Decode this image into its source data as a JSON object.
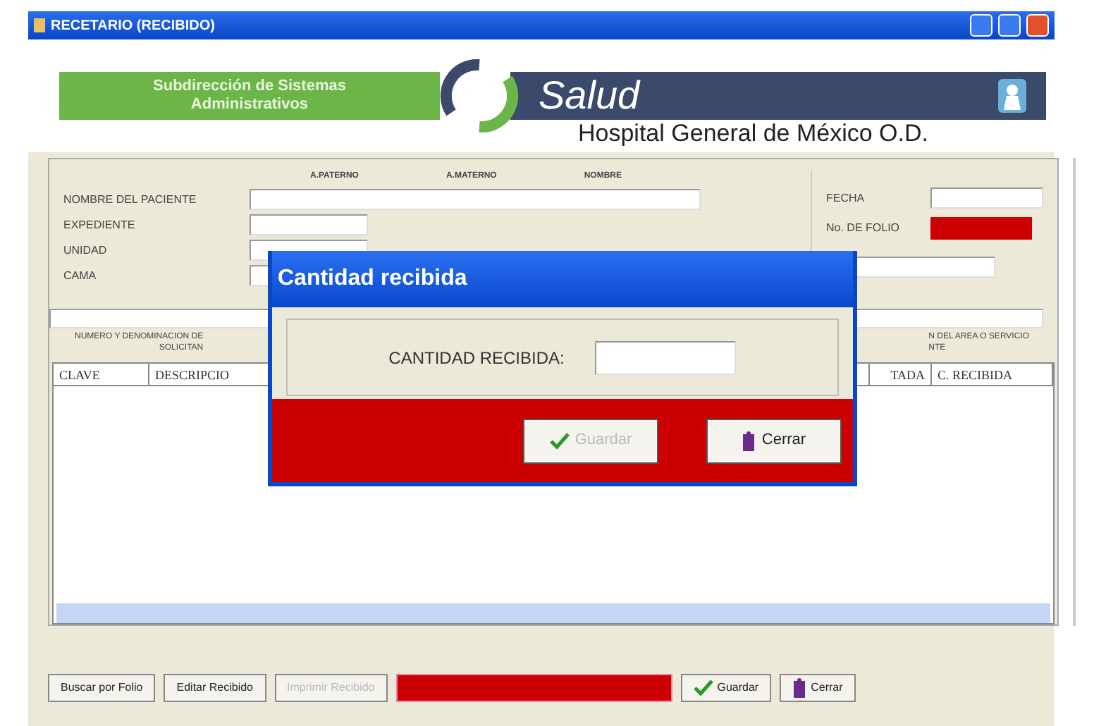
{
  "window": {
    "title": "RECETARIO (RECIBIDO)"
  },
  "banner": {
    "left_text": "Subdirección de Sistemas Administrativos",
    "brand": "Salud",
    "hospital": "Hospital General de México O.D."
  },
  "name_headers": [
    "A.PATERNO",
    "A.MATERNO",
    "NOMBRE"
  ],
  "fields": [
    {
      "label": "NOMBRE DEL PACIENTE",
      "kind": "wide"
    },
    {
      "label": "EXPEDIENTE",
      "kind": "short"
    },
    {
      "label": "UNIDAD",
      "kind": "short"
    },
    {
      "label": "CAMA",
      "kind": "short"
    }
  ],
  "right_fields": [
    {
      "label": "FECHA",
      "kind": "combo"
    },
    {
      "label": "No. DE FOLIO",
      "kind": "red"
    }
  ],
  "section_left": [
    "NUMERO Y DENOMINACION DE",
    "SOLICITAN"
  ],
  "section_right": [
    "N DEL AREA O SERVICIO",
    "NTE"
  ],
  "table": {
    "columns": [
      "CLAVE",
      "DESCRIPCIO",
      "",
      "TADA",
      "C. RECIBIDA"
    ]
  },
  "dialog": {
    "title": "Cantidad recibida",
    "label": "CANTIDAD RECIBIDA:",
    "buttons": [
      {
        "label": "Guardar",
        "kind": "save",
        "disabled": true
      },
      {
        "label": "Cerrar",
        "kind": "close",
        "disabled": false
      }
    ]
  },
  "bottom_buttons": [
    {
      "label": "Buscar por Folio",
      "kind": "plain",
      "disabled": false
    },
    {
      "label": "Editar Recibido",
      "kind": "plain",
      "disabled": false
    },
    {
      "label": "Imprimir Recibido",
      "kind": "plain",
      "disabled": true
    },
    {
      "kind": "status"
    },
    {
      "label": "Guardar",
      "kind": "save",
      "disabled": false
    },
    {
      "label": "Cerrar",
      "kind": "close",
      "disabled": false
    }
  ]
}
